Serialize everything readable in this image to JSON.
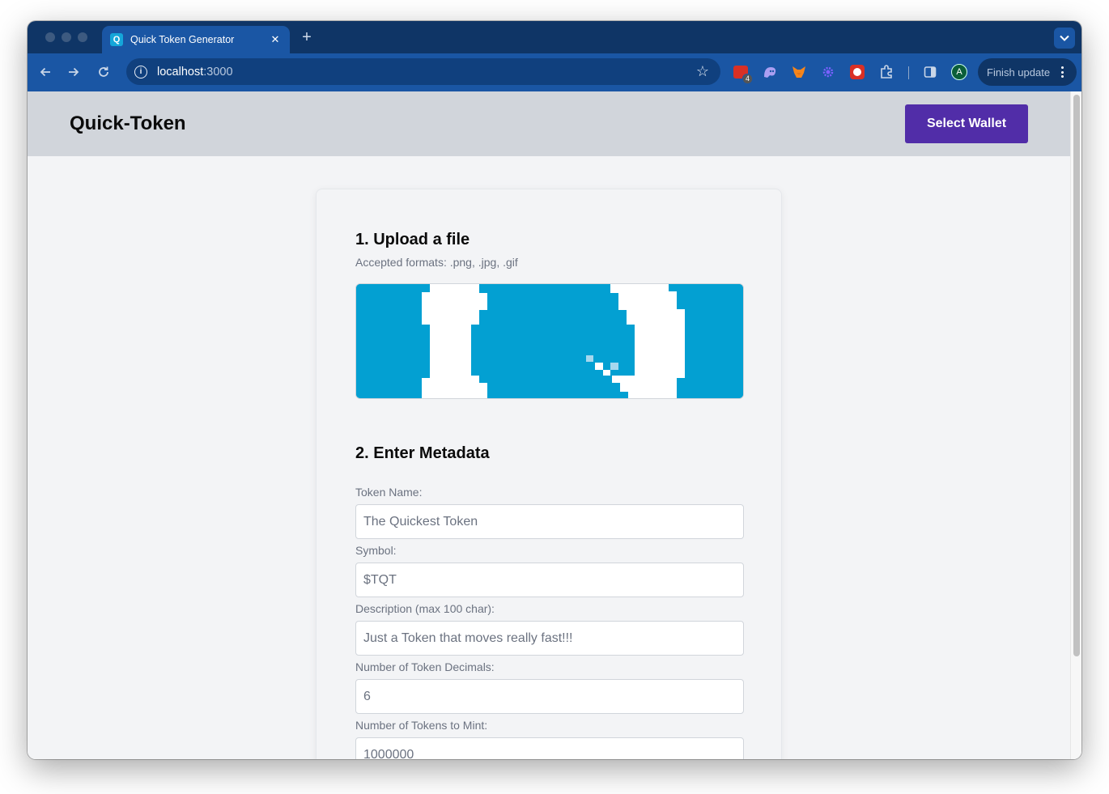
{
  "browser": {
    "tab": {
      "title": "Quick Token Generator",
      "favicon_letter": "Q"
    },
    "new_tab_icon": "plus-icon",
    "address": {
      "host": "localhost",
      "port": ":3000"
    },
    "finish_update_label": "Finish update",
    "profile_initial": "A",
    "extension_badge": "4"
  },
  "header": {
    "brand": "Quick-Token",
    "wallet_button": "Select Wallet",
    "accent_color": "#512da8"
  },
  "upload": {
    "title": "1. Upload a file",
    "hint": "Accepted formats: .png, .jpg, .gif",
    "preview_icon": "quick-token-logo-image"
  },
  "metadata": {
    "title": "2. Enter Metadata",
    "fields": [
      {
        "label": "Token Name:",
        "value": "The Quickest Token"
      },
      {
        "label": "Symbol:",
        "value": "$TQT"
      },
      {
        "label": "Description (max 100 char):",
        "value": "Just a Token that moves really fast!!!"
      },
      {
        "label": "Number of Token Decimals:",
        "value": "6"
      },
      {
        "label": "Number of Tokens to Mint:",
        "value": "1000000"
      }
    ]
  }
}
